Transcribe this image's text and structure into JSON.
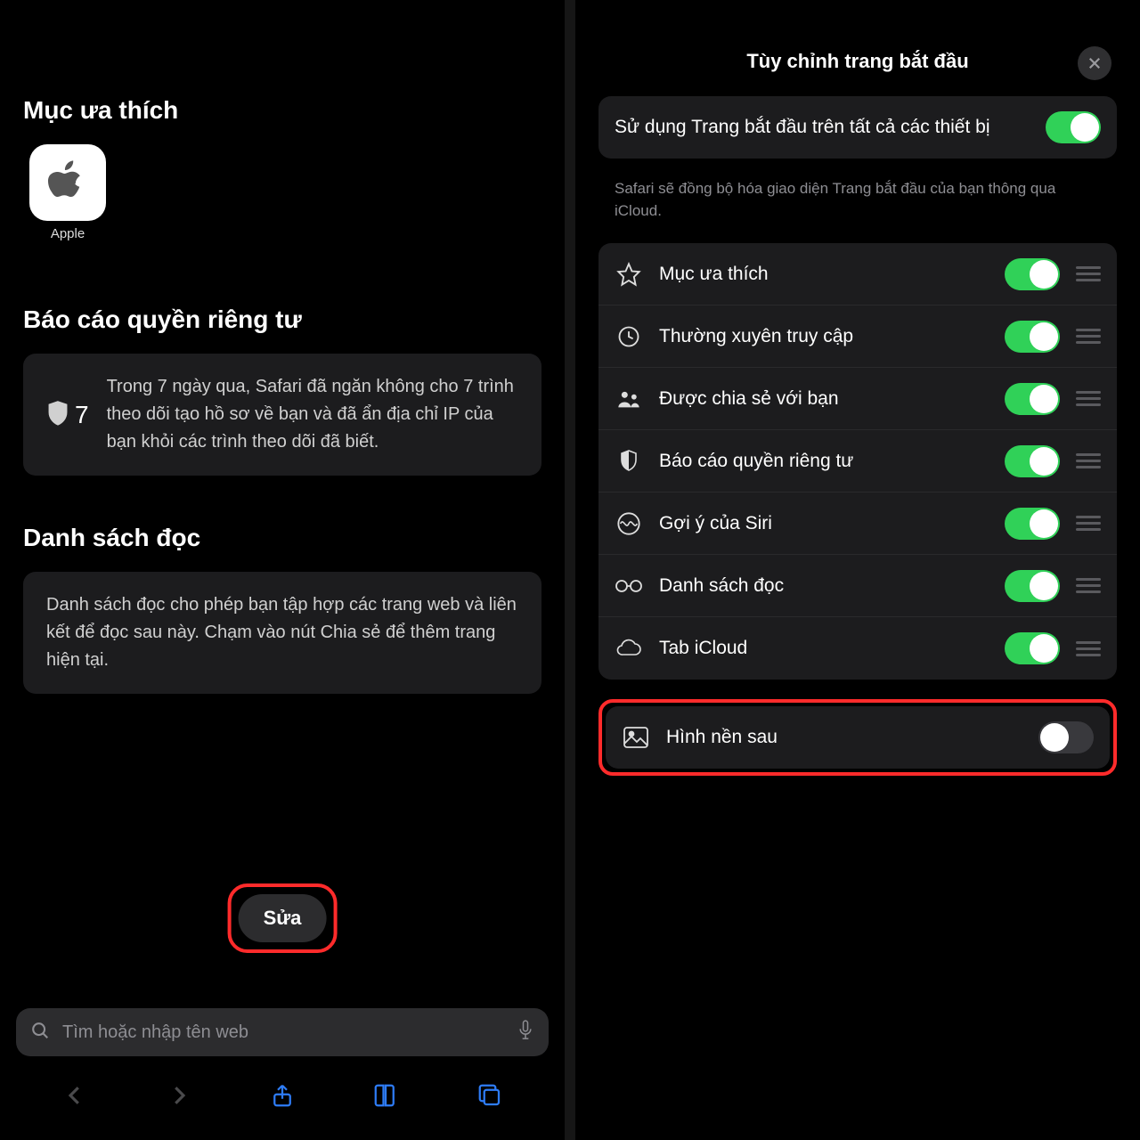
{
  "left": {
    "favorites_heading": "Mục ưa thích",
    "favorites": [
      {
        "label": "Apple"
      }
    ],
    "privacy_heading": "Báo cáo quyền riêng tư",
    "privacy_count": "7",
    "privacy_text": "Trong 7 ngày qua, Safari đã ngăn không cho 7 trình theo dõi tạo hồ sơ về bạn và đã ẩn địa chỉ IP của bạn khỏi các trình theo dõi đã biết.",
    "reading_heading": "Danh sách đọc",
    "reading_text": "Danh sách đọc cho phép bạn tập hợp các trang web và liên kết để đọc sau này. Chạm vào nút Chia sẻ để thêm trang hiện tại.",
    "edit_label": "Sửa",
    "search_placeholder": "Tìm hoặc nhập tên web"
  },
  "right": {
    "title": "Tùy chỉnh trang bắt đầu",
    "sync_label": "Sử dụng Trang bắt đầu trên tất cả các thiết bị",
    "sync_footnote": "Safari sẽ đồng bộ hóa giao diện Trang bắt đầu của bạn thông qua iCloud.",
    "rows": {
      "fav": "Mục ưa thích",
      "freq": "Thường xuyên truy cập",
      "shared": "Được chia sẻ với bạn",
      "priv": "Báo cáo quyền riêng tư",
      "siri": "Gợi ý của Siri",
      "read": "Danh sách đọc",
      "icloud": "Tab iCloud"
    },
    "background_label": "Hình nền sau"
  }
}
